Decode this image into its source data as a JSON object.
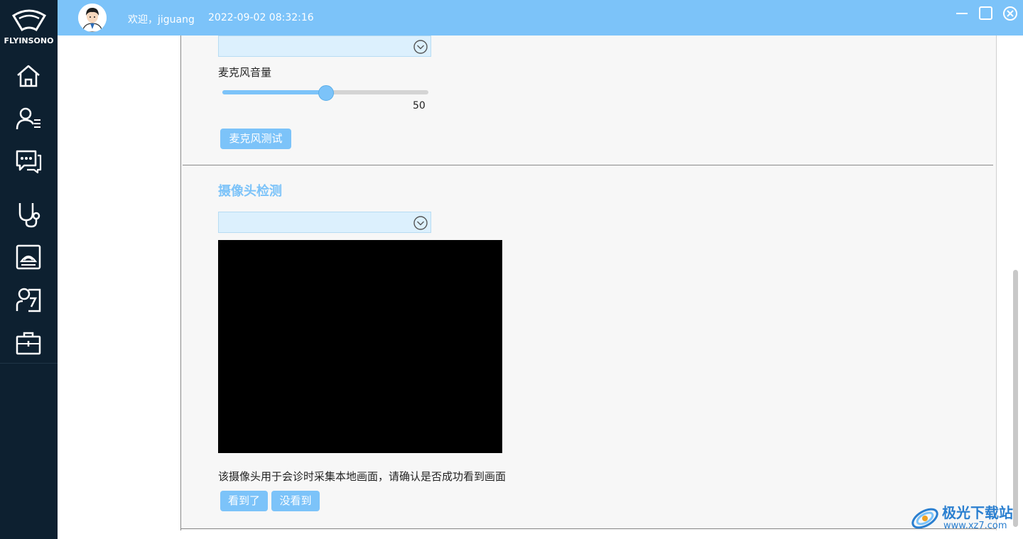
{
  "app": {
    "brand": "FLYINSONO"
  },
  "header": {
    "welcome": "欢迎，jiguang",
    "datetime": "2022-09-02 08:32:16",
    "user_avatar": "user-avatar"
  },
  "sidebar": {
    "items": [
      {
        "icon": "home-icon"
      },
      {
        "icon": "user-list-icon"
      },
      {
        "icon": "chat-icon"
      },
      {
        "icon": "stethoscope-icon"
      },
      {
        "icon": "ultrasound-icon"
      },
      {
        "icon": "consult-icon"
      },
      {
        "icon": "toolbox-icon"
      }
    ]
  },
  "mic": {
    "volume_label": "麦克风音量",
    "volume_value": "50",
    "volume_fraction": 0.5,
    "test_button": "麦克风测试"
  },
  "camera": {
    "section_title": "摄像头检测",
    "description": "该摄像头用于会诊时采集本地画面，请确认是否成功看到画面",
    "seen_button": "看到了",
    "not_seen_button": "没看到"
  },
  "watermark": {
    "name": "极光下载站",
    "url": "www.xz7.com"
  },
  "colors": {
    "accent": "#7cc3f9",
    "sidebar": "#0d2030",
    "panel": "#f7f7f7"
  }
}
